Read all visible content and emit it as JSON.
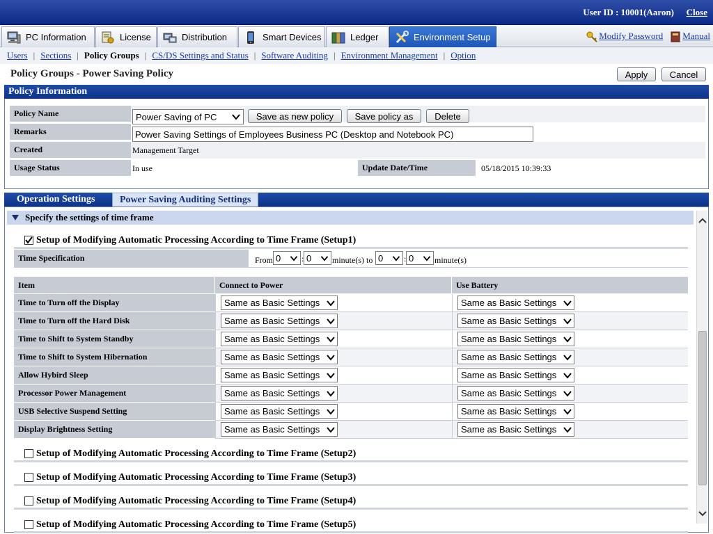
{
  "header": {
    "user_id": "User ID : 10001(Aaron)",
    "close": "Close"
  },
  "main_tabs": [
    {
      "label": "PC Information",
      "icon": "pc-icon"
    },
    {
      "label": "License",
      "icon": "license-icon"
    },
    {
      "label": "Distribution",
      "icon": "distribution-icon"
    },
    {
      "label": "Smart Devices",
      "icon": "smartphone-icon"
    },
    {
      "label": "Ledger",
      "icon": "ledger-icon"
    },
    {
      "label": "Environment Setup",
      "icon": "tools-icon",
      "active": true
    }
  ],
  "right_links": {
    "modify_password": "Modify Password",
    "manual": "Manual"
  },
  "subnav": {
    "items": [
      "Users",
      "Sections",
      "Policy Groups",
      "CS/DS Settings and Status",
      "Software Auditing",
      "Environment Management",
      "Option"
    ],
    "current": "Policy Groups"
  },
  "page": {
    "title": "Policy Groups - Power Saving Policy",
    "apply": "Apply",
    "cancel": "Cancel"
  },
  "policy_info": {
    "section_title": "Policy Information",
    "labels": {
      "name": "Policy Name",
      "remarks": "Remarks",
      "created": "Created",
      "usage": "Usage Status",
      "update": "Update Date/Time"
    },
    "policy_name": "Power Saving of PC",
    "buttons": {
      "save_new": "Save as new policy",
      "save_as": "Save policy as",
      "delete": "Delete"
    },
    "remarks": "Power Saving Settings of Employees Business PC (Desktop and Notebook PC)",
    "created": "Management Target",
    "usage_status": "In use",
    "update_datetime": "05/18/2015 10:39:33"
  },
  "sub_tabs": {
    "operation": "Operation Settings",
    "auditing": "Power Saving Auditing Settings"
  },
  "time_frame": {
    "section_title": "Specify the settings of time frame",
    "setup1": {
      "label": "Setup of Modifying Automatic Processing According to Time Frame (Setup1)",
      "checked": true
    },
    "time_spec": {
      "label": "Time Specification",
      "from": "From",
      "from_hour": "0",
      "from_minute": "0",
      "minutes_to": "minute(s) to",
      "to_hour": "0",
      "to_minute": "0",
      "minutes": "minute(s)"
    }
  },
  "settings_table": {
    "headers": {
      "item": "Item",
      "power": "Connect to Power",
      "battery": "Use Battery"
    },
    "rows": [
      {
        "item": "Time to Turn off the Display",
        "power": "Same as Basic Settings",
        "battery": "Same as Basic Settings"
      },
      {
        "item": "Time to Turn off the Hard Disk",
        "power": "Same as Basic Settings",
        "battery": "Same as Basic Settings"
      },
      {
        "item": "Time to Shift to System Standby",
        "power": "Same as Basic Settings",
        "battery": "Same as Basic Settings"
      },
      {
        "item": "Time to Shift to System Hibernation",
        "power": "Same as Basic Settings",
        "battery": "Same as Basic Settings"
      },
      {
        "item": "Allow Hybird Sleep",
        "power": "Same as Basic Settings",
        "battery": "Same as Basic Settings"
      },
      {
        "item": "Processor Power Management",
        "power": "Same as Basic Settings",
        "battery": "Same as Basic Settings"
      },
      {
        "item": "USB Selective Suspend Setting",
        "power": "Same as Basic Settings",
        "battery": "Same as Basic Settings"
      },
      {
        "item": "Display Brightness Setting",
        "power": "Same as Basic Settings",
        "battery": "Same as Basic Settings"
      }
    ]
  },
  "other_setups": [
    {
      "label": "Setup of Modifying Automatic Processing According to Time Frame (Setup2)",
      "checked": false
    },
    {
      "label": "Setup of Modifying Automatic Processing According to Time Frame (Setup3)",
      "checked": false
    },
    {
      "label": "Setup of Modifying Automatic Processing According to Time Frame (Setup4)",
      "checked": false
    },
    {
      "label": "Setup of Modifying Automatic Processing According to Time Frame (Setup5)",
      "checked": false
    }
  ],
  "colors": {
    "header_blue": "#0d3388",
    "active_tab": "#1d55b6",
    "label_gray": "#c6cbd4",
    "link": "#1a3ba8"
  }
}
